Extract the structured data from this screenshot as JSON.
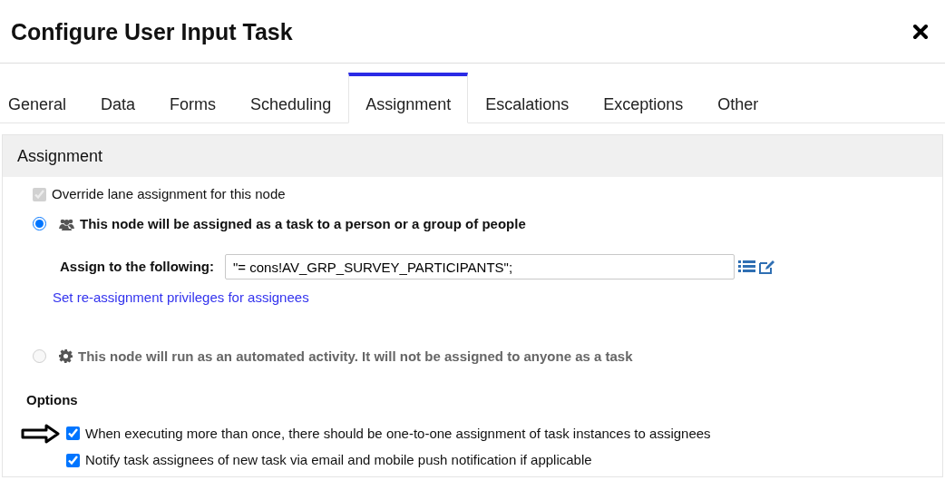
{
  "dialog": {
    "title": "Configure User Input Task"
  },
  "tabs": [
    {
      "label": "General",
      "selected": false
    },
    {
      "label": "Data",
      "selected": false
    },
    {
      "label": "Forms",
      "selected": false
    },
    {
      "label": "Scheduling",
      "selected": false
    },
    {
      "label": "Assignment",
      "selected": true
    },
    {
      "label": "Escalations",
      "selected": false
    },
    {
      "label": "Exceptions",
      "selected": false
    },
    {
      "label": "Other",
      "selected": false
    }
  ],
  "section": {
    "title": "Assignment"
  },
  "override": {
    "label": "Override lane assignment for this node",
    "checked": true,
    "disabled": true
  },
  "modes": [
    {
      "label": "This node will be assigned as a task to a person or a group of people",
      "kind": "people",
      "selected": true,
      "disabled": false
    },
    {
      "label": "This node will run as an automated activity. It will not be assigned to anyone as a task",
      "kind": "gear",
      "selected": false,
      "disabled": true
    }
  ],
  "assign": {
    "label": "Assign to the following:",
    "value": "\"= cons!AV_GRP_SURVEY_PARTICIPANTS\";",
    "link": "Set re-assignment privileges for assignees"
  },
  "options": {
    "title": "Options",
    "items": [
      {
        "label": "When executing more than once, there should be one-to-one assignment of task instances to assignees",
        "checked": true,
        "pointer": true
      },
      {
        "label": "Notify task assignees of new task via email and mobile push notification if applicable",
        "checked": true,
        "pointer": false
      }
    ]
  }
}
